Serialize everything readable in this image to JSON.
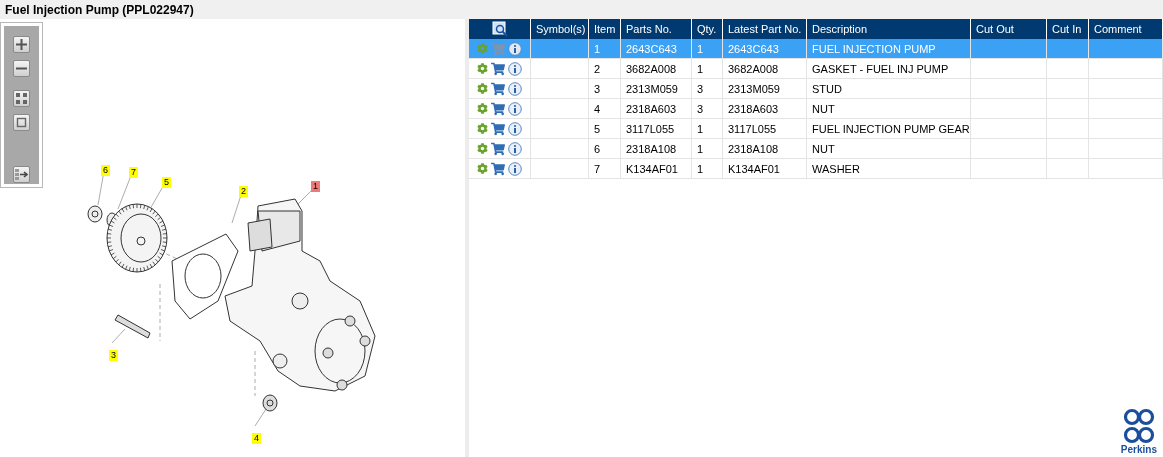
{
  "title": "Fuel Injection Pump (PPL022947)",
  "diagram": {
    "callouts": [
      {
        "label": "6",
        "selected": false
      },
      {
        "label": "7",
        "selected": false
      },
      {
        "label": "5",
        "selected": false
      },
      {
        "label": "2",
        "selected": false
      },
      {
        "label": "1",
        "selected": true
      },
      {
        "label": "3",
        "selected": false
      },
      {
        "label": "4",
        "selected": false
      }
    ]
  },
  "table": {
    "columns": [
      "Symbol(s)",
      "Item",
      "Parts No.",
      "Qty.",
      "Latest Part No.",
      "Description",
      "Cut Out",
      "Cut In",
      "Comment"
    ],
    "rows": [
      {
        "selected": true,
        "item": "1",
        "parts_no": "2643C643",
        "qty": "1",
        "latest_part_no": "2643C643",
        "description": "FUEL INJECTION PUMP"
      },
      {
        "selected": false,
        "item": "2",
        "parts_no": "3682A008",
        "qty": "1",
        "latest_part_no": "3682A008",
        "description": "GASKET - FUEL INJ PUMP"
      },
      {
        "selected": false,
        "item": "3",
        "parts_no": "2313M059",
        "qty": "3",
        "latest_part_no": "2313M059",
        "description": "STUD"
      },
      {
        "selected": false,
        "item": "4",
        "parts_no": "2318A603",
        "qty": "3",
        "latest_part_no": "2318A603",
        "description": "NUT"
      },
      {
        "selected": false,
        "item": "5",
        "parts_no": "3117L055",
        "qty": "1",
        "latest_part_no": "3117L055",
        "description": "FUEL INJECTION PUMP GEAR"
      },
      {
        "selected": false,
        "item": "6",
        "parts_no": "2318A108",
        "qty": "1",
        "latest_part_no": "2318A108",
        "description": "NUT"
      },
      {
        "selected": false,
        "item": "7",
        "parts_no": "K134AF01",
        "qty": "1",
        "latest_part_no": "K134AF01",
        "description": "WASHER"
      }
    ]
  },
  "logo": {
    "text": "Perkins"
  }
}
